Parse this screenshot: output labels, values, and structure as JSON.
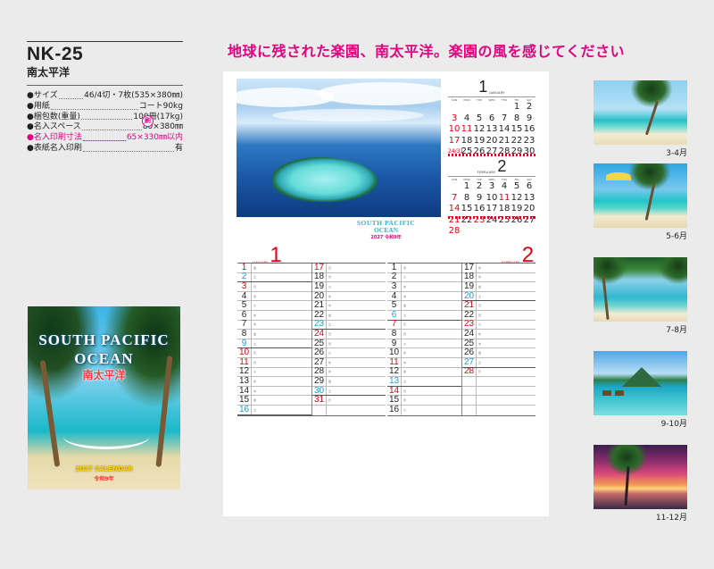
{
  "product": {
    "code": "NK-25",
    "name": "南太平洋",
    "specs": [
      {
        "label": "●サイズ",
        "value": "46/4切・7枚(535×380㎜)"
      },
      {
        "label": "●用紙",
        "value": "コート90kg"
      },
      {
        "label": "●梱包数(重量)",
        "value": "100冊(17kg)"
      },
      {
        "label": "●名入スペース",
        "value": "80×380㎜"
      },
      {
        "label": "●名入印刷寸法",
        "value": "65×330㎜以内"
      },
      {
        "label": "●表紙名入印刷",
        "value": "有"
      }
    ],
    "stamp": "刷"
  },
  "cover": {
    "title_line1": "SOUTH PACIFIC",
    "title_line2": "OCEAN",
    "title_jp": "南太平洋",
    "calendar_line": "2027 CALENDAR",
    "era_line": "令和9年"
  },
  "headline": "地球に残された楽園、南太平洋。楽園の風を感じてください",
  "sheet": {
    "mini_weekdays": [
      "SUN",
      "MON",
      "TUE",
      "WED",
      "THU",
      "FRI",
      "SAT"
    ],
    "mini_months": [
      {
        "name": "JANUARY",
        "number": "1",
        "days": [
          "",
          "",
          "",
          "",
          "",
          "1",
          "2",
          "3",
          "4",
          "5",
          "6",
          "7",
          "8",
          "9",
          "10",
          "11",
          "12",
          "13",
          "14",
          "15",
          "16",
          "17",
          "18",
          "19",
          "20",
          "21",
          "22",
          "23",
          "24/31",
          "25",
          "26",
          "27",
          "28",
          "29",
          "30"
        ]
      },
      {
        "name": "FEBRUARY",
        "number": "2",
        "days": [
          "",
          "1",
          "2",
          "3",
          "4",
          "5",
          "6",
          "7",
          "8",
          "9",
          "10",
          "11",
          "12",
          "13",
          "14",
          "15",
          "16",
          "17",
          "18",
          "19",
          "20",
          "21",
          "22",
          "23",
          "24",
          "25",
          "26",
          "27",
          "28"
        ]
      }
    ],
    "logo_line1": "SOUTH PACIFIC",
    "logo_line2": "OCEAN",
    "logo_line3": "2027 令和9年",
    "schedule": [
      {
        "name": "JANUARY",
        "number": "1",
        "col1": [
          {
            "d": "1",
            "w": "金",
            "t": "sun"
          },
          {
            "d": "2",
            "w": "土",
            "t": "sat"
          },
          {
            "d": "3",
            "w": "日",
            "t": "sun"
          },
          {
            "d": "4",
            "w": "月",
            "t": ""
          },
          {
            "d": "5",
            "w": "火",
            "t": ""
          },
          {
            "d": "6",
            "w": "水",
            "t": ""
          },
          {
            "d": "7",
            "w": "木",
            "t": ""
          },
          {
            "d": "8",
            "w": "金",
            "t": ""
          },
          {
            "d": "9",
            "w": "土",
            "t": "sat"
          },
          {
            "d": "10",
            "w": "日",
            "t": "sun"
          },
          {
            "d": "11",
            "w": "月",
            "t": "sun"
          },
          {
            "d": "12",
            "w": "火",
            "t": ""
          },
          {
            "d": "13",
            "w": "水",
            "t": ""
          },
          {
            "d": "14",
            "w": "木",
            "t": ""
          },
          {
            "d": "15",
            "w": "金",
            "t": ""
          },
          {
            "d": "16",
            "w": "土",
            "t": "sat"
          }
        ],
        "col2": [
          {
            "d": "17",
            "w": "日",
            "t": "sun"
          },
          {
            "d": "18",
            "w": "月",
            "t": ""
          },
          {
            "d": "19",
            "w": "火",
            "t": ""
          },
          {
            "d": "20",
            "w": "水",
            "t": ""
          },
          {
            "d": "21",
            "w": "木",
            "t": ""
          },
          {
            "d": "22",
            "w": "金",
            "t": ""
          },
          {
            "d": "23",
            "w": "土",
            "t": "sat"
          },
          {
            "d": "24",
            "w": "日",
            "t": "sun"
          },
          {
            "d": "25",
            "w": "月",
            "t": ""
          },
          {
            "d": "26",
            "w": "火",
            "t": ""
          },
          {
            "d": "27",
            "w": "水",
            "t": ""
          },
          {
            "d": "28",
            "w": "木",
            "t": ""
          },
          {
            "d": "29",
            "w": "金",
            "t": ""
          },
          {
            "d": "30",
            "w": "土",
            "t": "sat"
          },
          {
            "d": "31",
            "w": "日",
            "t": "sun"
          },
          {
            "d": "",
            "w": "",
            "t": ""
          }
        ]
      },
      {
        "name": "FEBRUARY",
        "number": "2",
        "col1": [
          {
            "d": "1",
            "w": "月",
            "t": ""
          },
          {
            "d": "2",
            "w": "火",
            "t": ""
          },
          {
            "d": "3",
            "w": "水",
            "t": ""
          },
          {
            "d": "4",
            "w": "木",
            "t": ""
          },
          {
            "d": "5",
            "w": "金",
            "t": ""
          },
          {
            "d": "6",
            "w": "土",
            "t": "sat"
          },
          {
            "d": "7",
            "w": "日",
            "t": "sun"
          },
          {
            "d": "8",
            "w": "月",
            "t": ""
          },
          {
            "d": "9",
            "w": "火",
            "t": ""
          },
          {
            "d": "10",
            "w": "水",
            "t": ""
          },
          {
            "d": "11",
            "w": "木",
            "t": "sun"
          },
          {
            "d": "12",
            "w": "金",
            "t": ""
          },
          {
            "d": "13",
            "w": "土",
            "t": "sat"
          },
          {
            "d": "14",
            "w": "日",
            "t": "sun"
          },
          {
            "d": "15",
            "w": "月",
            "t": ""
          },
          {
            "d": "16",
            "w": "火",
            "t": ""
          }
        ],
        "col2": [
          {
            "d": "17",
            "w": "水",
            "t": ""
          },
          {
            "d": "18",
            "w": "木",
            "t": ""
          },
          {
            "d": "19",
            "w": "金",
            "t": ""
          },
          {
            "d": "20",
            "w": "土",
            "t": "sat"
          },
          {
            "d": "21",
            "w": "日",
            "t": "sun"
          },
          {
            "d": "22",
            "w": "月",
            "t": ""
          },
          {
            "d": "23",
            "w": "火",
            "t": "sun"
          },
          {
            "d": "24",
            "w": "水",
            "t": ""
          },
          {
            "d": "25",
            "w": "木",
            "t": ""
          },
          {
            "d": "26",
            "w": "金",
            "t": ""
          },
          {
            "d": "27",
            "w": "土",
            "t": "sat"
          },
          {
            "d": "28",
            "w": "日",
            "t": "sun"
          },
          {
            "d": "",
            "w": "",
            "t": ""
          },
          {
            "d": "",
            "w": "",
            "t": ""
          },
          {
            "d": "",
            "w": "",
            "t": ""
          },
          {
            "d": "",
            "w": "",
            "t": ""
          }
        ]
      }
    ]
  },
  "thumbnails": [
    {
      "label": "3-4月"
    },
    {
      "label": "5-6月"
    },
    {
      "label": "7-8月"
    },
    {
      "label": "9-10月"
    },
    {
      "label": "11-12月"
    }
  ],
  "colors": {
    "accent": "#e4007f",
    "sunday": "#e60012",
    "saturday": "#1ba0d8"
  }
}
